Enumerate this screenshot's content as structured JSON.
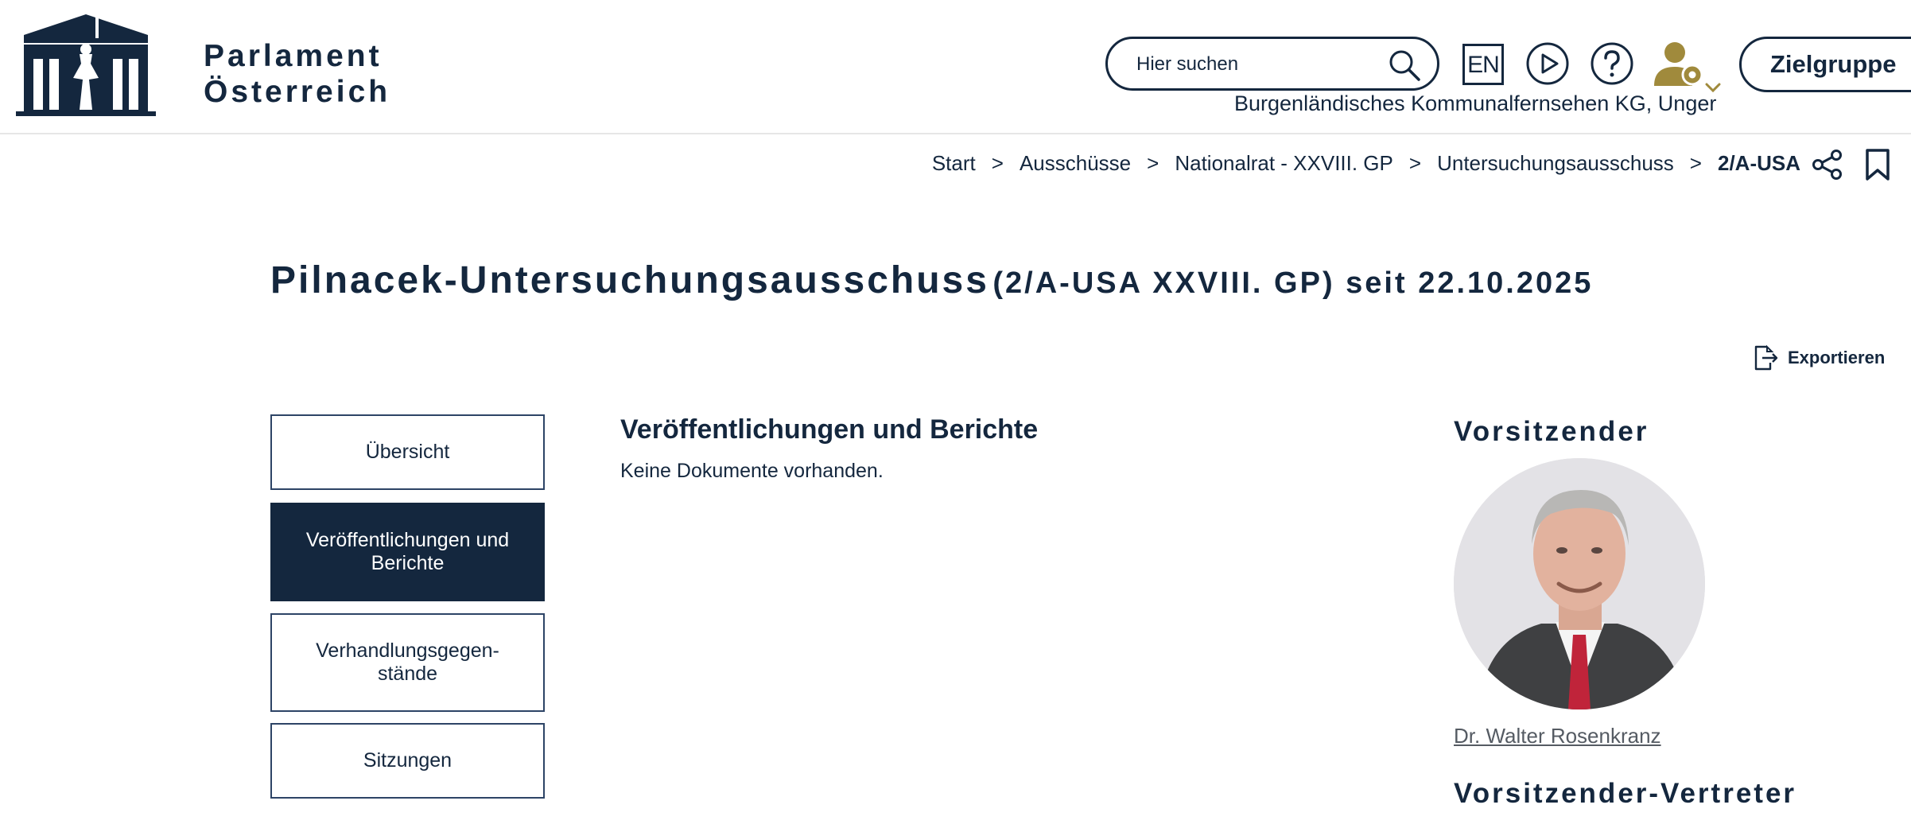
{
  "header": {
    "brand_line1": "Parlament",
    "brand_line2": "Österreich",
    "search_placeholder": "Hier suchen",
    "lang_label": "EN",
    "audience_label": "Zielgruppe",
    "user_name": "Burgenländisches Kommunalfernsehen KG, Unger"
  },
  "breadcrumb": {
    "items": [
      "Start",
      "Ausschüsse",
      "Nationalrat - XXVIII. GP",
      "Untersuchungsausschuss"
    ],
    "current": "2/A-USA",
    "separator": ">"
  },
  "page": {
    "title_main": "Pilnacek-Untersuchungsausschuss",
    "title_sub": "(2/A-USA XXVIII. GP) seit 22.10.2025",
    "export_label": "Exportieren"
  },
  "sidebar": {
    "items": [
      {
        "label": "Übersicht",
        "active": false
      },
      {
        "label": "Veröffentlichungen und Berichte",
        "active": true
      },
      {
        "label": "Verhandlungsgegen-stände",
        "active": false
      },
      {
        "label": "Sitzungen",
        "active": false
      }
    ]
  },
  "main": {
    "section_title": "Veröffentlichungen und Berichte",
    "empty_text": "Keine Dokumente vorhanden."
  },
  "aside": {
    "chair_heading": "Vorsitzender",
    "chair_name": "Dr. Walter Rosenkranz",
    "deputy_heading": "Vorsitzender-Vertreter"
  },
  "colors": {
    "brand_navy": "#14273e",
    "user_icon_gold": "#a08a3c"
  },
  "icons": [
    "parliament-logo-icon",
    "search-icon",
    "play-icon",
    "help-icon",
    "user-settings-icon",
    "share-icon",
    "bookmark-icon",
    "export-icon"
  ]
}
